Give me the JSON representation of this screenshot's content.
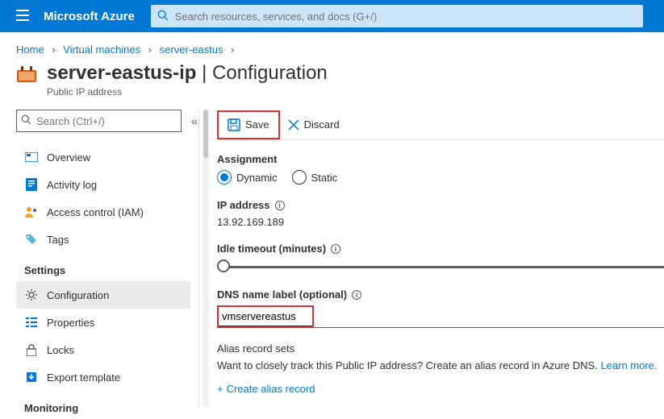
{
  "brand": "Microsoft Azure",
  "global_search_placeholder": "Search resources, services, and docs (G+/)",
  "breadcrumb": {
    "items": [
      "Home",
      "Virtual machines",
      "server-eastus"
    ]
  },
  "title": {
    "name": "server-eastus-ip",
    "separator": " | ",
    "page": "Configuration",
    "subtitle": "Public IP address"
  },
  "sidebar": {
    "search_placeholder": "Search (Ctrl+/)",
    "items": [
      {
        "label": "Overview"
      },
      {
        "label": "Activity log"
      },
      {
        "label": "Access control (IAM)"
      },
      {
        "label": "Tags"
      }
    ],
    "section1": "Settings",
    "settings": [
      {
        "label": "Configuration"
      },
      {
        "label": "Properties"
      },
      {
        "label": "Locks"
      },
      {
        "label": "Export template"
      }
    ],
    "section2": "Monitoring"
  },
  "toolbar": {
    "save": "Save",
    "discard": "Discard"
  },
  "fields": {
    "assignment": {
      "label": "Assignment",
      "options": [
        "Dynamic",
        "Static"
      ],
      "selected": "Dynamic"
    },
    "ip": {
      "label": "IP address",
      "value": "13.92.169.189"
    },
    "idle": {
      "label": "Idle timeout (minutes)"
    },
    "dns": {
      "label": "DNS name label (optional)",
      "value": "vmservereastus"
    },
    "alias": {
      "label": "Alias record sets",
      "text": "Want to closely track this Public IP address? Create an alias record in Azure DNS. ",
      "learn_more": "Learn more.",
      "create": "Create alias record"
    }
  }
}
